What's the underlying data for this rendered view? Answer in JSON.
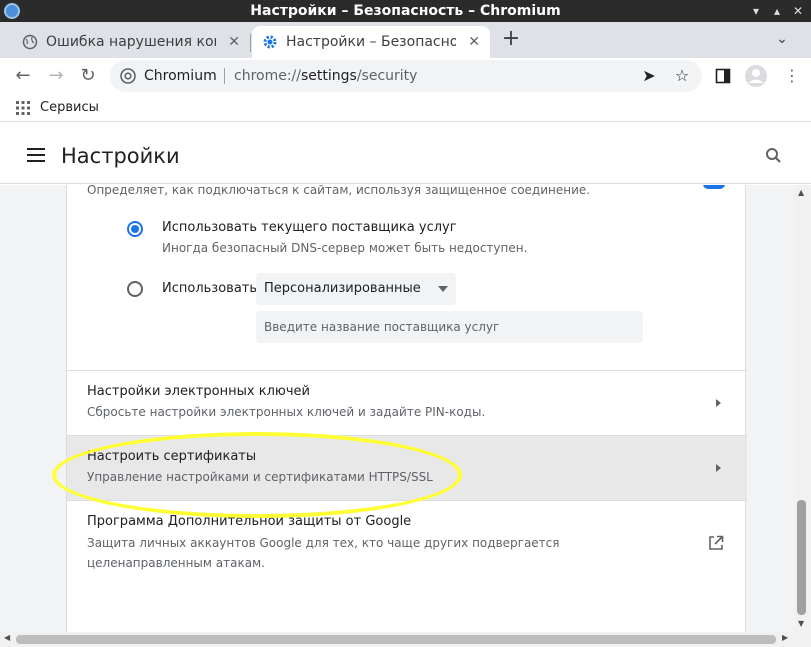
{
  "window": {
    "title": "Настройки – Безопасность – Chromium"
  },
  "tabs": [
    {
      "label": "Ошибка нарушения конфиденциальности",
      "active": false
    },
    {
      "label": "Настройки – Безопасность",
      "active": true
    }
  ],
  "omnibox": {
    "site": "Chromium",
    "url_prefix": "chrome://",
    "url_host": "settings",
    "url_path": "/security"
  },
  "bookmarks": {
    "label": "Сервисы"
  },
  "settings": {
    "title": "Настройки"
  },
  "dns": {
    "description": "Определяет, как подключаться к сайтам, используя защищенное соединение.",
    "option_current": {
      "label": "Использовать текущего поставщика услуг",
      "sub": "Иногда безопасный DNS-сервер может быть недоступен."
    },
    "option_custom": {
      "label": "Использовать",
      "select_value": "Персонализированные",
      "input_placeholder": "Введите название поставщика услуг"
    }
  },
  "rows": {
    "security_keys": {
      "title": "Настройки электронных ключей",
      "sub": "Сбросьте настройки электронных ключей и задайте PIN-коды."
    },
    "certificates": {
      "title": "Настроить сертификаты",
      "sub": "Управление настройками и сертификатами HTTPS/SSL"
    },
    "advanced_protection": {
      "title": "Программа Дополнительной защиты от Google",
      "sub": "Защита личных аккаунтов Google для тех, кто чаще других подвергается целенаправленным атакам."
    }
  },
  "colors": {
    "accent": "#1a73e8",
    "highlight": "#ffff33"
  }
}
